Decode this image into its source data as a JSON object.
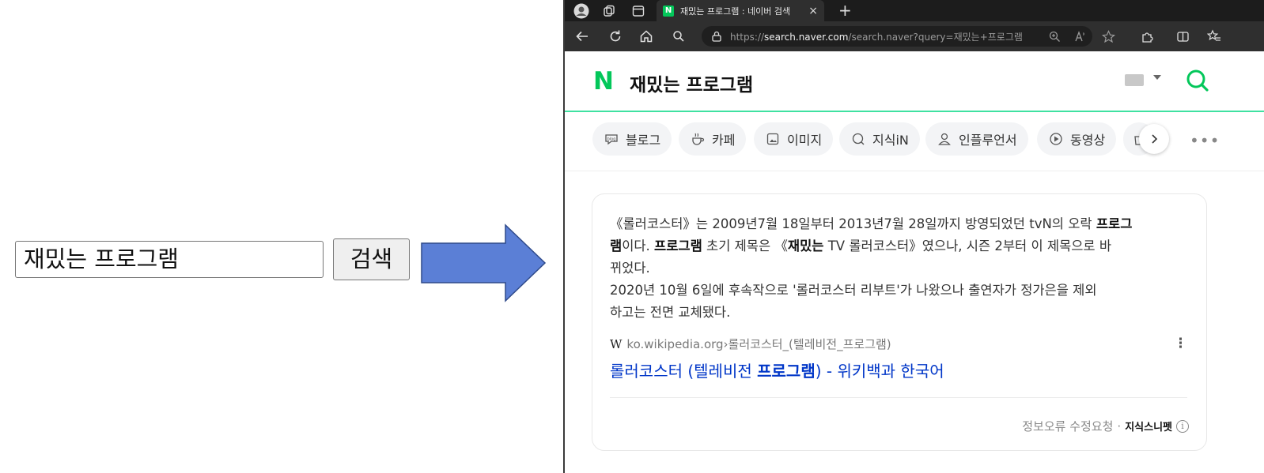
{
  "demo": {
    "search_value": "재밌는 프로그램",
    "search_button_label": "검색"
  },
  "browser": {
    "tab_title": "재밌는 프로그램 : 네이버 검색",
    "tab_close": "×",
    "new_tab": "+",
    "url_scheme": "https://",
    "url_host": "search.naver.com",
    "url_path": "/search.naver?query=재밌는+프로그램"
  },
  "naver": {
    "logo": "N",
    "query": "재밌는 프로그램",
    "tabs": [
      {
        "label": "블로그",
        "icon": "blog-icon"
      },
      {
        "label": "카페",
        "icon": "cafe-icon"
      },
      {
        "label": "이미지",
        "icon": "image-icon"
      },
      {
        "label": "지식iN",
        "icon": "kin-icon"
      },
      {
        "label": "인플루언서",
        "icon": "person-icon"
      },
      {
        "label": "동영상",
        "icon": "play-icon"
      }
    ],
    "snippet": {
      "l1_a": "《롤러코스터》는 2009년7월 18일부터 2013년7월 28일까지 방영되었던 tvN의 오락 ",
      "l1_b": "프로그",
      "l2_a": "램",
      "l2_b": "이다. ",
      "l2_c": "프로그램",
      "l2_d": " 초기 제목은 《",
      "l2_e": "재밌는",
      "l2_f": " TV 롤러코스터》였으나, 시즌 2부터 이 제목으로 바",
      "l3": "뀌었다.",
      "l4": "2020년 10월 6일에 후속작으로 '롤러코스터 리부트'가 나왔으나 출연자가 정가은을 제외",
      "l5": "하고는 전면 교체됐다."
    },
    "source": {
      "w": "W",
      "domain": "ko.wikipedia.org",
      "sep": " › ",
      "path": "롤러코스터_(텔레비전_프로그램)"
    },
    "link": {
      "a": "롤러코스터 (텔레비전 ",
      "b": "프로그램",
      "c": ") - 위키백과 한국어"
    },
    "footer": {
      "report": "정보오류 수정요청",
      "dot": "·",
      "brand": "지식스니펫",
      "info": "i"
    }
  },
  "colors": {
    "naver_green": "#03c75a",
    "arrow_fill": "#5b7fd6",
    "link_blue": "#0036c8"
  }
}
